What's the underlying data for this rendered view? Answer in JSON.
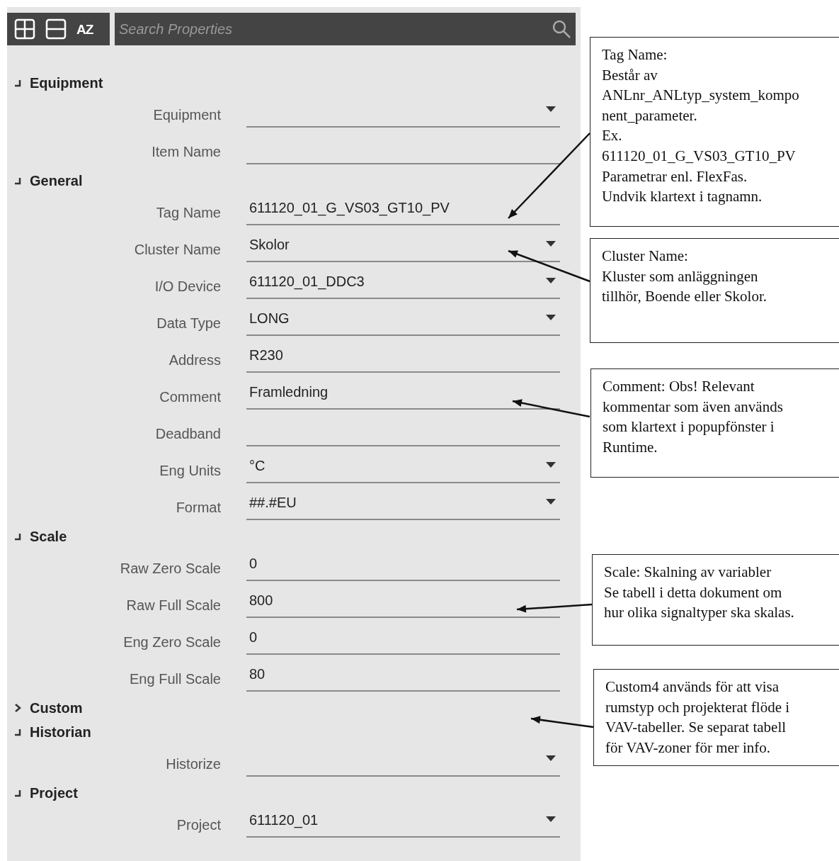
{
  "toolbar": {
    "sort_label": "AZ",
    "search": {
      "placeholder": "Search Properties"
    }
  },
  "sections": [
    {
      "title": "Equipment",
      "expanded": true,
      "properties": [
        {
          "label": "Equipment",
          "kind": "dropdown"
        },
        {
          "label": "Item Name",
          "kind": "text"
        }
      ]
    },
    {
      "title": "General",
      "expanded": true,
      "properties": [
        {
          "label": "Tag Name",
          "value": "611120_01_G_VS03_GT10_PV",
          "kind": "text"
        },
        {
          "label": "Cluster Name",
          "value": "Skolor",
          "kind": "dropdown"
        },
        {
          "label": "I/O Device",
          "value": "611120_01_DDC3",
          "kind": "dropdown"
        },
        {
          "label": "Data Type",
          "value": "LONG",
          "kind": "dropdown"
        },
        {
          "label": "Address",
          "value": "R230",
          "kind": "text"
        },
        {
          "label": "Comment",
          "value": "Framledning",
          "kind": "text"
        },
        {
          "label": "Deadband",
          "kind": "text"
        },
        {
          "label": "Eng Units",
          "value": "°C",
          "kind": "dropdown"
        },
        {
          "label": "Format",
          "value": "##.#EU",
          "kind": "dropdown"
        }
      ]
    },
    {
      "title": "Scale",
      "expanded": true,
      "properties": [
        {
          "label": "Raw Zero Scale",
          "value": "0",
          "kind": "text"
        },
        {
          "label": "Raw Full Scale",
          "value": "800",
          "kind": "text"
        },
        {
          "label": "Eng Zero Scale",
          "value": "0",
          "kind": "text"
        },
        {
          "label": "Eng Full Scale",
          "value": "80",
          "kind": "text"
        }
      ]
    },
    {
      "title": "Custom",
      "expanded": false
    },
    {
      "title": "Historian",
      "expanded": true,
      "properties": [
        {
          "label": "Historize",
          "kind": "dropdown"
        }
      ]
    },
    {
      "title": "Project",
      "expanded": true,
      "properties": [
        {
          "label": "Project",
          "value": "611120_01",
          "kind": "dropdown"
        }
      ]
    }
  ],
  "notes": [
    {
      "text": "Tag Name:\nBestår av\nANLnr_ANLtyp_system_kompo\nnent_parameter.\nEx.\n611120_01_G_VS03_GT10_PV\nParametrar enl. FlexFas.\nUndvik klartext i tagnamn."
    },
    {
      "text": "Cluster Name:\nKluster som anläggningen\ntillhör, Boende eller Skolor."
    },
    {
      "text": "Comment: Obs! Relevant\nkommentar som även används\nsom klartext i popupfönster i\nRuntime."
    },
    {
      "text": "Scale: Skalning av variabler\nSe tabell i detta dokument om\nhur olika signaltyper ska skalas."
    },
    {
      "text": "Custom4 används för att visa\nrumstyp och projekterat flöde i\nVAV-tabeller. Se separat tabell\nför VAV-zoner för mer info."
    }
  ]
}
